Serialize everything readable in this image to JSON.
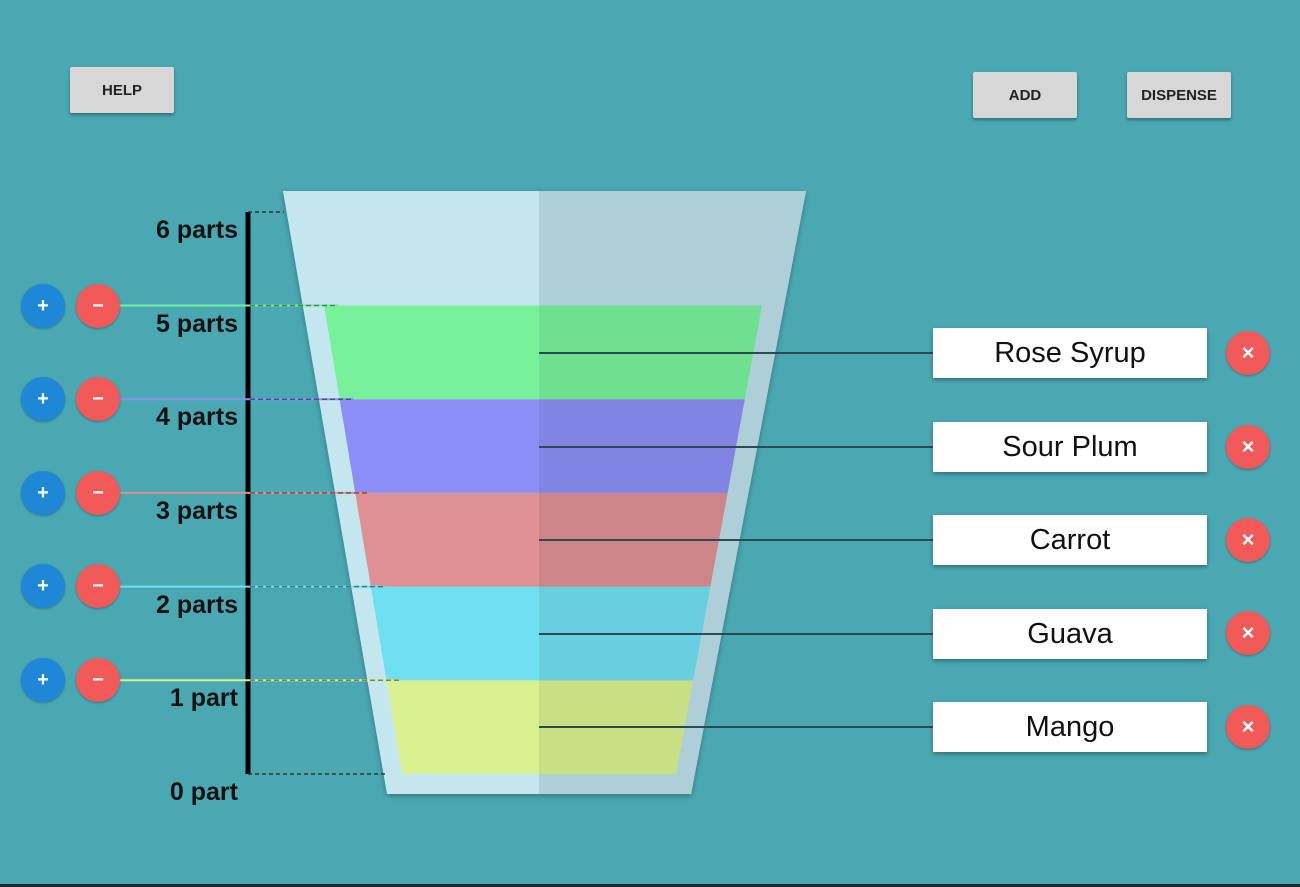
{
  "toolbar": {
    "help_label": "HELP",
    "add_label": "ADD",
    "dispense_label": "DISPENSE"
  },
  "scale": {
    "labels": [
      "6 parts",
      "5 parts",
      "4 parts",
      "3 parts",
      "2 parts",
      "1 part",
      "0 part"
    ]
  },
  "layer_controls": {
    "plus_symbol": "+",
    "minus_symbol": "−"
  },
  "ingredients": [
    {
      "name": "Rose Syrup",
      "color": "#78f29a",
      "parts": 1
    },
    {
      "name": "Sour Plum",
      "color": "#8b8ff5",
      "parts": 1
    },
    {
      "name": "Carrot",
      "color": "#de9094",
      "parts": 1
    },
    {
      "name": "Guava",
      "color": "#6fdff2",
      "parts": 1
    },
    {
      "name": "Mango",
      "color": "#d8f08f",
      "parts": 1
    }
  ],
  "remove_symbol": "×",
  "colors": {
    "background": "#4aa8b3",
    "button": "#d7d7d7",
    "plus": "#1e88d6",
    "minus": "#f25a5a",
    "glass": "#c4e6ef"
  }
}
